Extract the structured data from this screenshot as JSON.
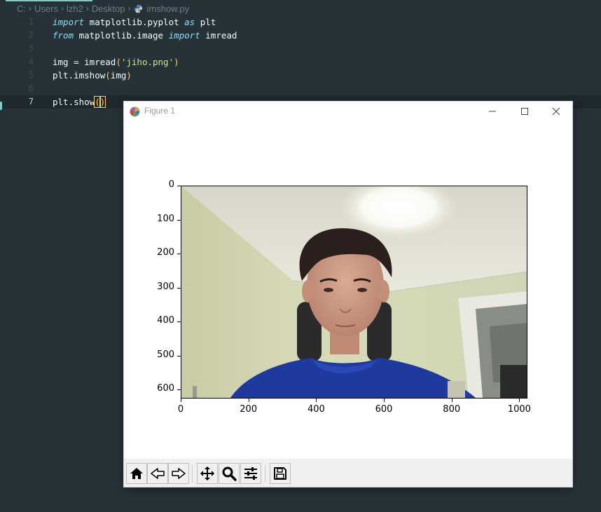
{
  "editor": {
    "breadcrumb": [
      "C:",
      "Users",
      "lzh2",
      "Desktop",
      "imshow.py"
    ],
    "lines": [
      {
        "n": "1"
      },
      {
        "n": "2"
      },
      {
        "n": "3"
      },
      {
        "n": "4"
      },
      {
        "n": "5"
      },
      {
        "n": "6"
      },
      {
        "n": "7"
      }
    ],
    "tokens": {
      "import": "import",
      "from": "from",
      "as": "as",
      "mod1": " matplotlib.pyplot ",
      "alias": " plt",
      "mod2": " matplotlib.image ",
      "imread_name": " imread",
      "assign": "img = imread",
      "fname": "'jiho.png'",
      "imshow_call": "plt.imshow",
      "img_arg": "img",
      "show_call": "plt.show",
      "open_paren": "(",
      "close_paren": ")"
    },
    "colors": {
      "background": "#263238",
      "keyword": "#89ddff",
      "string": "#c3e88d",
      "paren": "#ffcb6b"
    }
  },
  "figure_window": {
    "title": "Figure 1",
    "y_ticks": [
      "0",
      "100",
      "200",
      "300",
      "400",
      "500",
      "600"
    ],
    "x_ticks": [
      "0",
      "200",
      "400",
      "600",
      "800",
      "1000"
    ],
    "image_extent": {
      "x": [
        0,
        1024
      ],
      "y": [
        0,
        626
      ]
    },
    "toolbar_buttons": [
      "home-icon",
      "back-icon",
      "forward-icon",
      "pan-icon",
      "zoom-icon",
      "configure-subplots-icon",
      "save-icon"
    ]
  }
}
